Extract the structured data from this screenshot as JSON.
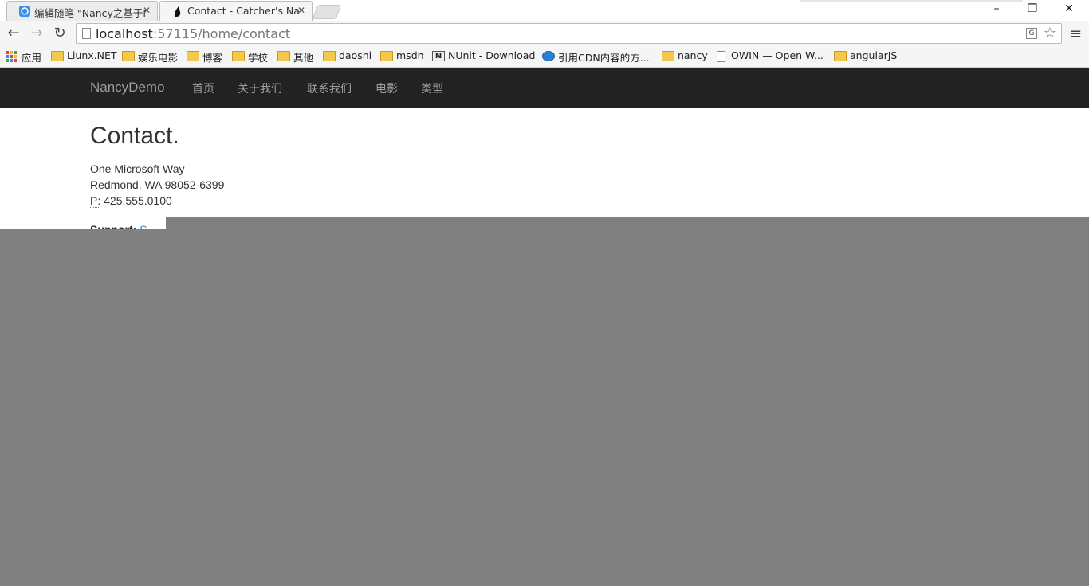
{
  "browser": {
    "tabs": [
      {
        "title": "编辑随笔 \"Nancy之基于N",
        "active": false
      },
      {
        "title": "Contact - Catcher's Nan",
        "active": true
      }
    ],
    "url_host": "localhost",
    "url_rest": ":57115/home/contact",
    "bookmarks": [
      {
        "label": "应用",
        "icon": "apps-icon"
      },
      {
        "label": "Liunx.NET",
        "icon": "folder-icon"
      },
      {
        "label": "娱乐电影",
        "icon": "folder-icon"
      },
      {
        "label": "博客",
        "icon": "folder-icon"
      },
      {
        "label": "学校",
        "icon": "folder-icon"
      },
      {
        "label": "其他",
        "icon": "folder-icon"
      },
      {
        "label": "daoshi",
        "icon": "folder-icon"
      },
      {
        "label": "msdn",
        "icon": "folder-icon"
      },
      {
        "label": "NUnit - Download",
        "icon": "nunit-icon"
      },
      {
        "label": "引用CDN内容的方...",
        "icon": "globe-icon"
      },
      {
        "label": "nancy",
        "icon": "folder-icon"
      },
      {
        "label": "OWIN — Open W...",
        "icon": "page-icon"
      },
      {
        "label": "angularJS",
        "icon": "folder-icon"
      }
    ]
  },
  "navbar": {
    "brand": "NancyDemo",
    "links": [
      "首页",
      "关于我们",
      "联系我们",
      "电影",
      "类型"
    ]
  },
  "page": {
    "heading": "Contact.",
    "address_line1": "One Microsoft Way",
    "address_line2": "Redmond, WA 98052-6399",
    "phone_abbr": "P:",
    "phone": " 425.555.0100",
    "support_label": "Support:",
    "support_link": "S..."
  },
  "colors": {
    "navbar_bg": "#222222",
    "overlay": "#808080",
    "link": "#428bca"
  }
}
